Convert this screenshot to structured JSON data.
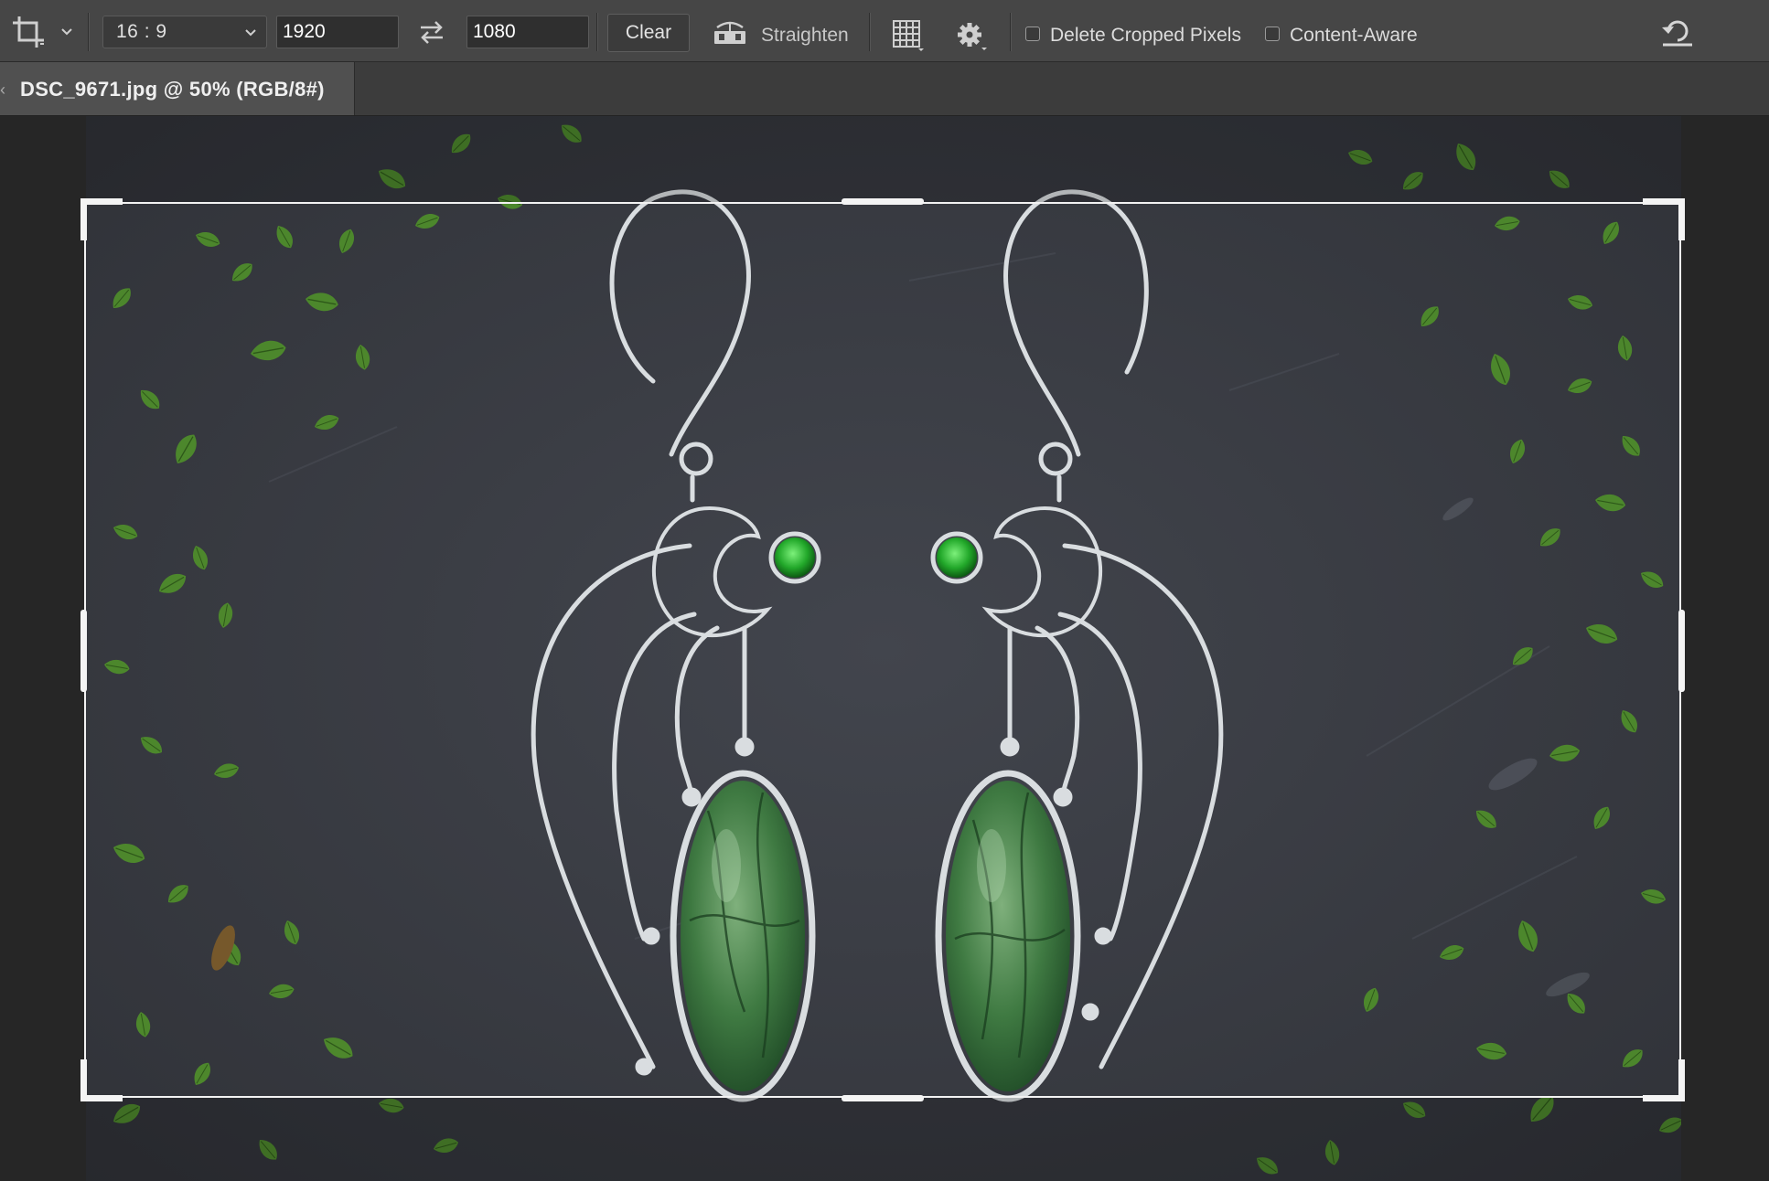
{
  "options_bar": {
    "tool_icon": "crop-icon",
    "aspect_ratio": "16 : 9",
    "width_value": "1920",
    "height_value": "1080",
    "swap_icon": "swap-arrows-icon",
    "clear_label": "Clear",
    "straighten_label": "Straighten",
    "overlay_icon": "grid-overlay-icon",
    "settings_icon": "gear-icon",
    "delete_cropped_label": "Delete Cropped Pixels",
    "delete_cropped_checked": false,
    "content_aware_label": "Content-Aware",
    "content_aware_checked": false,
    "reset_icon": "reset-icon"
  },
  "document": {
    "tab_title": "DSC_9671.jpg @ 50% (RGB/8#)"
  },
  "colors": {
    "toolbar_bg": "#464646",
    "tab_bg": "#505050",
    "canvas_bg": "#262626",
    "slate": "#3b3d44",
    "leaf_green": "#4e8a2c",
    "stone_green": "#3d7a3e",
    "silver": "#d9dde0",
    "gem_green": "#27b32c"
  }
}
